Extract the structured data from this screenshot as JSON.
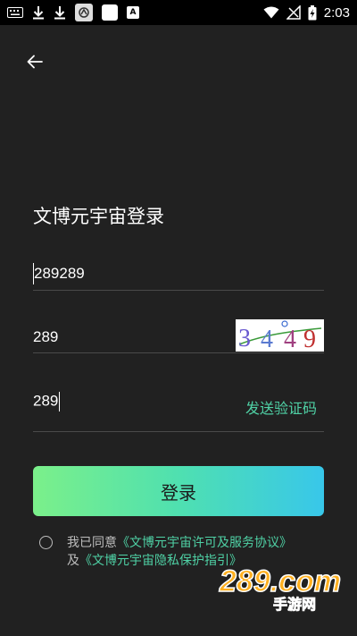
{
  "status_bar": {
    "time": "2:03",
    "left_icons": [
      "keyboard-icon",
      "download-icon",
      "download-icon",
      "app-icon",
      "white-square-icon",
      "a-icon"
    ],
    "right_icons": [
      "wifi-icon",
      "no-sim-icon",
      "battery-charging-icon"
    ]
  },
  "page": {
    "title": "文博元宇宙登录"
  },
  "form": {
    "account_value": "289289",
    "captcha_input_value": "289",
    "captcha_image_text": "3449",
    "sms_code_value": "289",
    "send_code_label": "发送验证码",
    "login_label": "登录"
  },
  "agreement": {
    "prefix": "我已同意",
    "terms_link": "《文博元宇宙许可及服务协议》",
    "and": "及",
    "privacy_link": "《文博元宇宙隐私保护指引》",
    "checked": false
  },
  "watermark": {
    "brand": "289.com",
    "sub": "手游网"
  },
  "colors": {
    "background": "#212121",
    "accent": "#4fd1a5",
    "button_gradient_start": "#7bf08a",
    "button_gradient_end": "#38c7ea"
  }
}
